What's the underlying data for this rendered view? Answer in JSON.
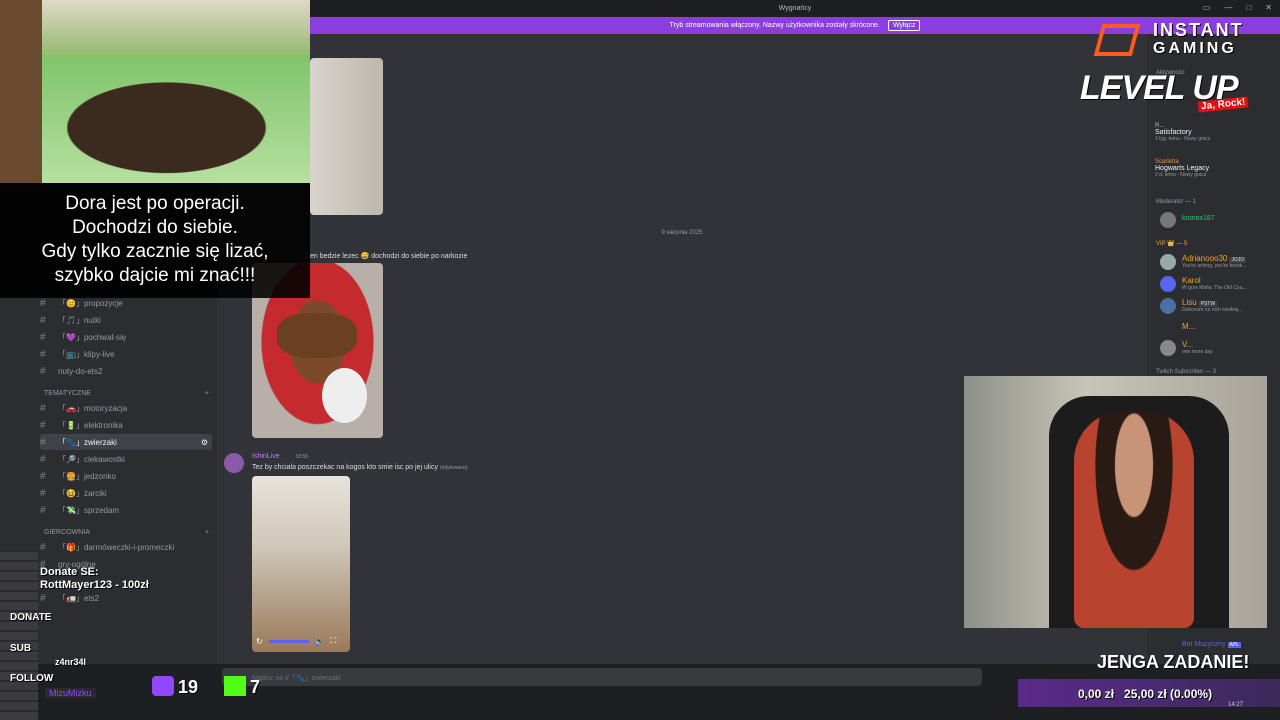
{
  "window": {
    "title": "Wygnańcy",
    "stream_banner": "Tryb streamowania włączony. Nazwy użytkownika zostały skrócone.",
    "stream_banner_button": "Wyłącz"
  },
  "sidebar": {
    "channels_top": [
      {
        "label": "「😊」propozycje"
      },
      {
        "label": "「🎵」nutki"
      },
      {
        "label": "「💜」pochwal-się"
      },
      {
        "label": "「📺」klipy-live"
      },
      {
        "label": "nuty-do-ets2"
      }
    ],
    "category_tematyczne": "TEMATYCZNE",
    "channels_tematyczne": [
      {
        "label": "「🚗」motoryzacja"
      },
      {
        "label": "「🔋」elektronika"
      },
      {
        "label": "「🐾」zwierzaki",
        "active": true
      },
      {
        "label": "「🔎」ciekawostki"
      },
      {
        "label": "「🍔」jedzonko"
      },
      {
        "label": "「😆」żarciki"
      },
      {
        "label": "「💸」sprzedam"
      }
    ],
    "category_giercownia": "GIERCOWNIA",
    "channels_giercownia": [
      {
        "label": "「🎁」darmóweczki-i-promeczki"
      },
      {
        "label": "gry-ogólne"
      },
      {
        "label": "「🚛」ets2"
      }
    ]
  },
  "chat": {
    "date_separator": "9 sierpnia 2025",
    "message1_text": "en bedzie lezec 😅 dochodzi do siebie po narkozie",
    "message2_author": "IshinLive",
    "message2_time": "10:55",
    "message2_text": "Tez by chciala poszczekac na kogos kto smie isc po jej ulicy",
    "message2_edited": "(edytowano)",
    "input_placeholder": "Napisz na #「🐾」zwierzaki"
  },
  "members": {
    "section_active": "Aktywność",
    "activity_items": [
      {
        "name": "R...",
        "game": "Satisfactory",
        "sub": "3 tyg. temu · Nowy gracz"
      },
      {
        "name": "Scarletta",
        "game": "Hogwarts Legacy",
        "sub": "2 d. temu · Nowy gracz"
      }
    ],
    "moderator_header": "Moderator — 1",
    "moderator": "kronox187",
    "vip_header": "VIP 👑 — 5",
    "vips": [
      {
        "name": "Adrianooo30",
        "tag": "JOJO",
        "status": "You're aching, you're break...",
        "color": "#f0a12e"
      },
      {
        "name": "Karol",
        "status": "W grze Mafia: The Old Cou...",
        "color": "#f0a12e"
      },
      {
        "name": "Lisu",
        "tag": "PSTW",
        "status": "Dokonam na nich wielkiej...",
        "color": "#f0a12e"
      },
      {
        "name": "M...",
        "status": "",
        "color": "#f0a12e"
      },
      {
        "name": "V...",
        "status": "one more day",
        "color": "#f0a12e"
      }
    ],
    "twitch_header": "Twitch Subscriber — 3",
    "bot": "Bot Muzyczny",
    "bot_tag": "APL"
  },
  "overlay": {
    "caption_lines": [
      "Dora jest po operacji.",
      "Dochodzi do siebie.",
      "Gdy tylko zacznie się lizać,",
      "szybko dajcie mi znać!!!"
    ],
    "brand_top": "INSTANT",
    "brand_bottom": "GAMING",
    "level_up": "LEVEL UP",
    "level_up_sub": "Ja, Rock!",
    "donate_label": "Donate SE:",
    "donate_entry": "RottMayer123 - 100zł",
    "donate": "DONATE",
    "sub": "SUB",
    "sub_name": "z4nr34l",
    "follow": "FOLLOW",
    "follow_name": "MizuMizku",
    "twitch_count": "19",
    "kick_count": "7",
    "jenga": "JENGA ZADANIE!",
    "goal": "0,00 zł   25,00 zł (0.00%)",
    "clock": "14:27"
  },
  "colors": {
    "discord_bg": "#313338",
    "sidebar_bg": "#2b2d31",
    "stream_banner": "#8a3fdc",
    "brand_orange": "#ff5a1f",
    "kick_green": "#53fc18",
    "twitch_purple": "#9146ff"
  }
}
